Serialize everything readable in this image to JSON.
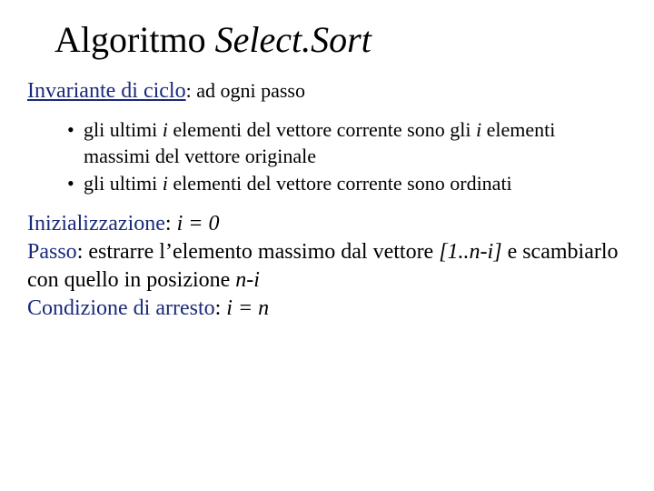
{
  "title_part1": "Algoritmo ",
  "title_part2": "Select.Sort",
  "invariant_label": "Invariante di ciclo",
  "invariant_suffix": ": ad ogni passo",
  "bullets": [
    {
      "p1": "gli ultimi ",
      "i1": "i",
      "p2": " elementi del vettore corrente sono gli ",
      "i2": "i",
      "p3": " elementi massimi del vettore originale"
    },
    {
      "p1": "gli ultimi ",
      "i1": "i",
      "p2": " elementi del vettore corrente sono ordinati",
      "i2": "",
      "p3": ""
    }
  ],
  "init_label": "Inizializzazione",
  "init_value": "i = 0",
  "step_label": "Passo",
  "step_p1": ": estrarre l’elemento massimo dal vettore ",
  "step_range": "[1..n-i]",
  "step_p2": " e scambiarlo con quello in posizione ",
  "step_pos": "n-i",
  "stop_label": "Condizione di arresto",
  "stop_value": "i = n"
}
